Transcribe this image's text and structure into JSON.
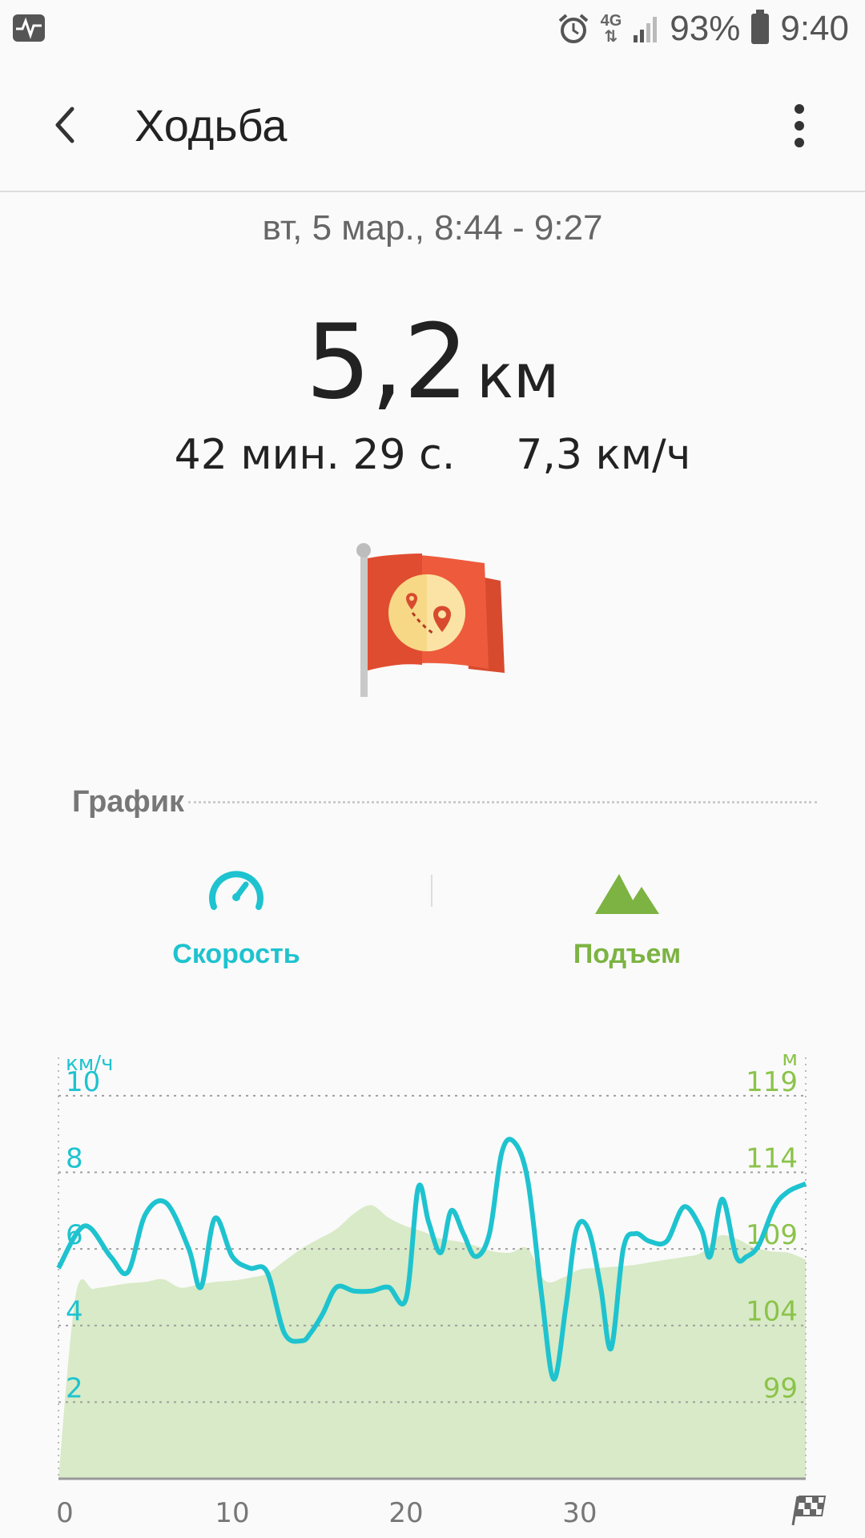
{
  "status_bar": {
    "network": "4G",
    "battery": "93%",
    "time": "9:40"
  },
  "app_bar": {
    "title": "Ходьба"
  },
  "summary": {
    "date": "вт, 5 мар., 8:44 - 9:27",
    "distance_value": "5,2",
    "distance_unit": "км",
    "duration": "42 мин. 29 с.",
    "avg_speed": "7,3 км/ч"
  },
  "section": {
    "title": "График"
  },
  "tabs": [
    {
      "label": "Скорость",
      "color": "#1ec3cf"
    },
    {
      "label": "Подъем",
      "color": "#7cb342"
    }
  ],
  "colors": {
    "speed": "#1ec3cf",
    "elevation": "#7cb342",
    "elevation_fill": "#d8eac7",
    "flag": "#e8543a"
  },
  "chart_data": {
    "type": "line",
    "x_ticks": [
      "0",
      "10",
      "20",
      "30"
    ],
    "left_unit": "км/ч",
    "right_unit": "м",
    "left_ticks": [
      "10",
      "8",
      "6",
      "4",
      "2"
    ],
    "right_ticks": [
      "119",
      "114",
      "109",
      "104",
      "99"
    ],
    "left_range": [
      0,
      11
    ],
    "right_range": [
      92.2,
      122.4
    ],
    "x_range": [
      0,
      43
    ],
    "grid": true,
    "series": [
      {
        "axis": "left",
        "color": "#1ec3cf",
        "x": [
          0,
          1.5,
          3,
          4,
          5,
          6.2,
          7.5,
          8.2,
          9,
          10,
          11,
          12,
          13,
          14,
          14.5,
          15.2,
          16,
          17,
          18,
          19,
          20,
          20.7,
          21.3,
          22,
          22.6,
          23.3,
          24,
          24.8,
          25.5,
          26.2,
          27,
          27.8,
          28.5,
          29.2,
          29.8,
          30.5,
          31.2,
          31.8,
          32.5,
          33.2,
          34,
          35,
          36,
          37,
          37.5,
          38.2,
          39,
          39.6,
          40.3,
          41.2,
          42,
          43
        ],
        "values": [
          5.5,
          6.6,
          5.8,
          5.4,
          6.9,
          7.2,
          6,
          5,
          6.8,
          5.8,
          5.5,
          5.4,
          3.8,
          3.6,
          3.8,
          4.3,
          5,
          4.9,
          4.9,
          5,
          4.7,
          7.6,
          6.7,
          5.9,
          7,
          6.4,
          5.8,
          6.4,
          8.5,
          8.8,
          7.8,
          4.8,
          2.6,
          4.5,
          6.5,
          6.5,
          5,
          3.4,
          6,
          6.4,
          6.2,
          6.2,
          7.1,
          6.5,
          5.8,
          7.3,
          5.8,
          5.8,
          6.1,
          7.1,
          7.5,
          7.7
        ]
      },
      {
        "axis": "right",
        "color": "#d8eac7",
        "x": [
          0,
          1,
          2,
          3,
          4,
          5,
          6,
          7,
          8,
          9,
          10,
          11,
          12,
          13,
          14,
          15,
          16,
          17,
          18,
          19,
          20,
          21,
          22,
          23,
          24,
          25,
          26,
          27,
          28,
          29,
          30,
          31,
          32,
          33,
          34,
          35,
          36,
          37,
          38,
          39,
          40,
          41,
          42,
          43
        ],
        "values": [
          92.2,
          105.4,
          105.8,
          106,
          106.2,
          106.3,
          106.5,
          105.9,
          106.1,
          106.3,
          106.4,
          106.6,
          106.9,
          107.8,
          108.7,
          109.4,
          110.1,
          111.2,
          111.8,
          110.9,
          110.3,
          109.9,
          109.4,
          109.2,
          108.9,
          108.5,
          108.4,
          108.7,
          106.4,
          106.6,
          107.2,
          107.3,
          107.4,
          107.5,
          107.7,
          107.9,
          108.1,
          108.4,
          109.6,
          109.4,
          108.8,
          108.5,
          108.4,
          107.9
        ]
      }
    ]
  }
}
